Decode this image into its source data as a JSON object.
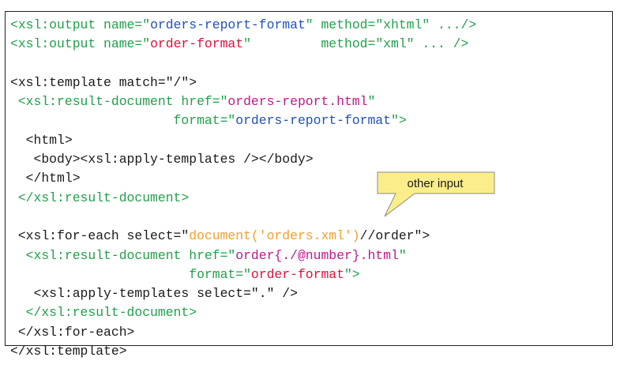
{
  "code_lines": [
    [
      {
        "t": "<xsl:output name=\"",
        "c": "green"
      },
      {
        "t": "orders-report-format",
        "c": "blue"
      },
      {
        "t": "\" method=\"xhtml\" .../>",
        "c": "green"
      }
    ],
    [
      {
        "t": "<xsl:output name=\"",
        "c": "green"
      },
      {
        "t": "order-format",
        "c": "red"
      },
      {
        "t": "\"         method=\"xml\" ... />",
        "c": "green"
      }
    ],
    [],
    [
      {
        "t": "<xsl:template match=\"/\">",
        "c": "black"
      }
    ],
    [
      {
        "t": " <xsl:result-document href=\"",
        "c": "green"
      },
      {
        "t": "orders-report.html",
        "c": "magenta"
      },
      {
        "t": "\"",
        "c": "green"
      }
    ],
    [
      {
        "t": "                     format=\"",
        "c": "green"
      },
      {
        "t": "orders-report-format",
        "c": "blue"
      },
      {
        "t": "\">",
        "c": "green"
      }
    ],
    [
      {
        "t": "  <html>",
        "c": "black"
      }
    ],
    [
      {
        "t": "   <body><xsl:apply-templates /></body>",
        "c": "black"
      }
    ],
    [
      {
        "t": "  </html>",
        "c": "black"
      }
    ],
    [
      {
        "t": " </xsl:result-document>",
        "c": "green"
      }
    ],
    [],
    [
      {
        "t": " <xsl:for-each select=\"",
        "c": "black"
      },
      {
        "t": "document('orders.xml')",
        "c": "orange"
      },
      {
        "t": "//order\">",
        "c": "black"
      }
    ],
    [
      {
        "t": "  <xsl:result-document href=\"",
        "c": "green"
      },
      {
        "t": "order{./@number}.html",
        "c": "magenta"
      },
      {
        "t": "\"",
        "c": "green"
      }
    ],
    [
      {
        "t": "                       format=\"",
        "c": "green"
      },
      {
        "t": "order-format",
        "c": "red"
      },
      {
        "t": "\">",
        "c": "green"
      }
    ],
    [
      {
        "t": "   <xsl:apply-templates select=\".\" />",
        "c": "black"
      }
    ],
    [
      {
        "t": "  </xsl:result-document>",
        "c": "green"
      }
    ],
    [
      {
        "t": " </xsl:for-each>",
        "c": "black"
      }
    ],
    [
      {
        "t": "</xsl:template>",
        "c": "black"
      }
    ]
  ],
  "callout": {
    "label": "other input",
    "fill": "#fbee8a",
    "stroke": "#8a8a8a"
  },
  "colors": {
    "green": "#22a04b",
    "blue": "#2050b8",
    "red": "#e0103a",
    "magenta": "#c0188a",
    "orange": "#f0a030",
    "black": "#1a1a1a"
  }
}
